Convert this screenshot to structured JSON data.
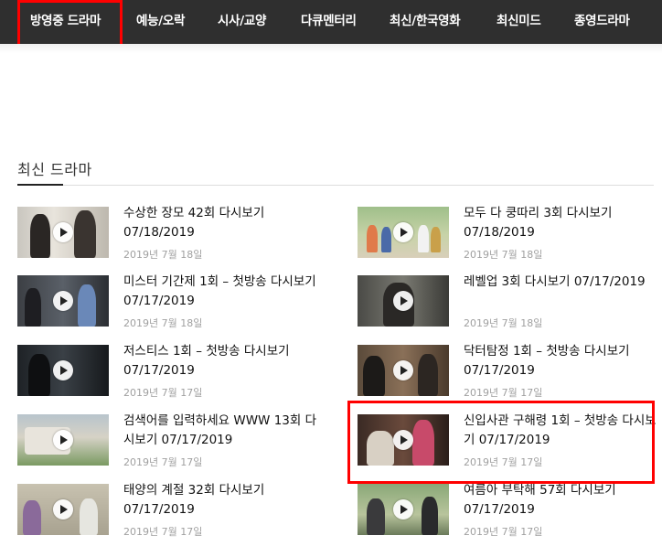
{
  "nav": {
    "items": [
      "방영중 드라마",
      "예능/오락",
      "시사/교양",
      "다큐멘터리",
      "최신/한국영화",
      "최신미드",
      "종영드라마"
    ]
  },
  "section": {
    "title": "최신 드라마"
  },
  "posts": [
    {
      "title": "수상한 장모 42회 다시보기 07/18/2019",
      "date": "2019년 7월 18일"
    },
    {
      "title": "모두 다 쿵따리 3회 다시보기 07/18/2019",
      "date": "2019년 7월 18일"
    },
    {
      "title": "미스터 기간제 1회 – 첫방송 다시보기 07/17/2019",
      "date": "2019년 7월 18일"
    },
    {
      "title": "레벨업 3회 다시보기 07/17/2019",
      "date": "2019년 7월 18일"
    },
    {
      "title": "저스티스 1회 – 첫방송 다시보기 07/17/2019",
      "date": "2019년 7월 17일"
    },
    {
      "title": "닥터탐정 1회 – 첫방송 다시보기 07/17/2019",
      "date": "2019년 7월 17일"
    },
    {
      "title": "검색어를 입력하세요 WWW 13회 다시보기 07/17/2019",
      "date": "2019년 7월 17일"
    },
    {
      "title": "신입사관 구해령 1회 – 첫방송 다시보기 07/17/2019",
      "date": "2019년 7월 17일"
    },
    {
      "title": "태양의 계절 32회 다시보기 07/17/2019",
      "date": "2019년 7월 17일"
    },
    {
      "title": "여름아 부탁해 57회 다시보기 07/17/2019",
      "date": "2019년 7월 17일"
    }
  ],
  "icons": {
    "play": "play-circle-icon"
  },
  "colors": {
    "nav_bg": "#2f2f2f",
    "highlight": "#ff0000",
    "date": "#a0a0a0"
  }
}
